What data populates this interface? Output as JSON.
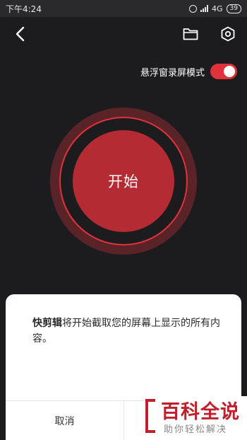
{
  "status_bar": {
    "time": "下午4:24",
    "network": "4G",
    "battery": "39"
  },
  "header": {
    "back_icon": "chevron-left-icon",
    "folder_icon": "folder-icon",
    "settings_icon": "hexagon-gear-icon"
  },
  "floating_mode": {
    "label": "悬浮窗录屏模式",
    "enabled": true,
    "accent_color": "#e0323a"
  },
  "record": {
    "label": "开始",
    "button_color": "#b42b33"
  },
  "dialog": {
    "app_name": "快剪辑",
    "message": "将开始截取您的屏幕上显示的所有内容。",
    "cancel_label": "取消"
  },
  "watermark": {
    "title": "百科全说",
    "subtitle": "助你轻松解决"
  }
}
